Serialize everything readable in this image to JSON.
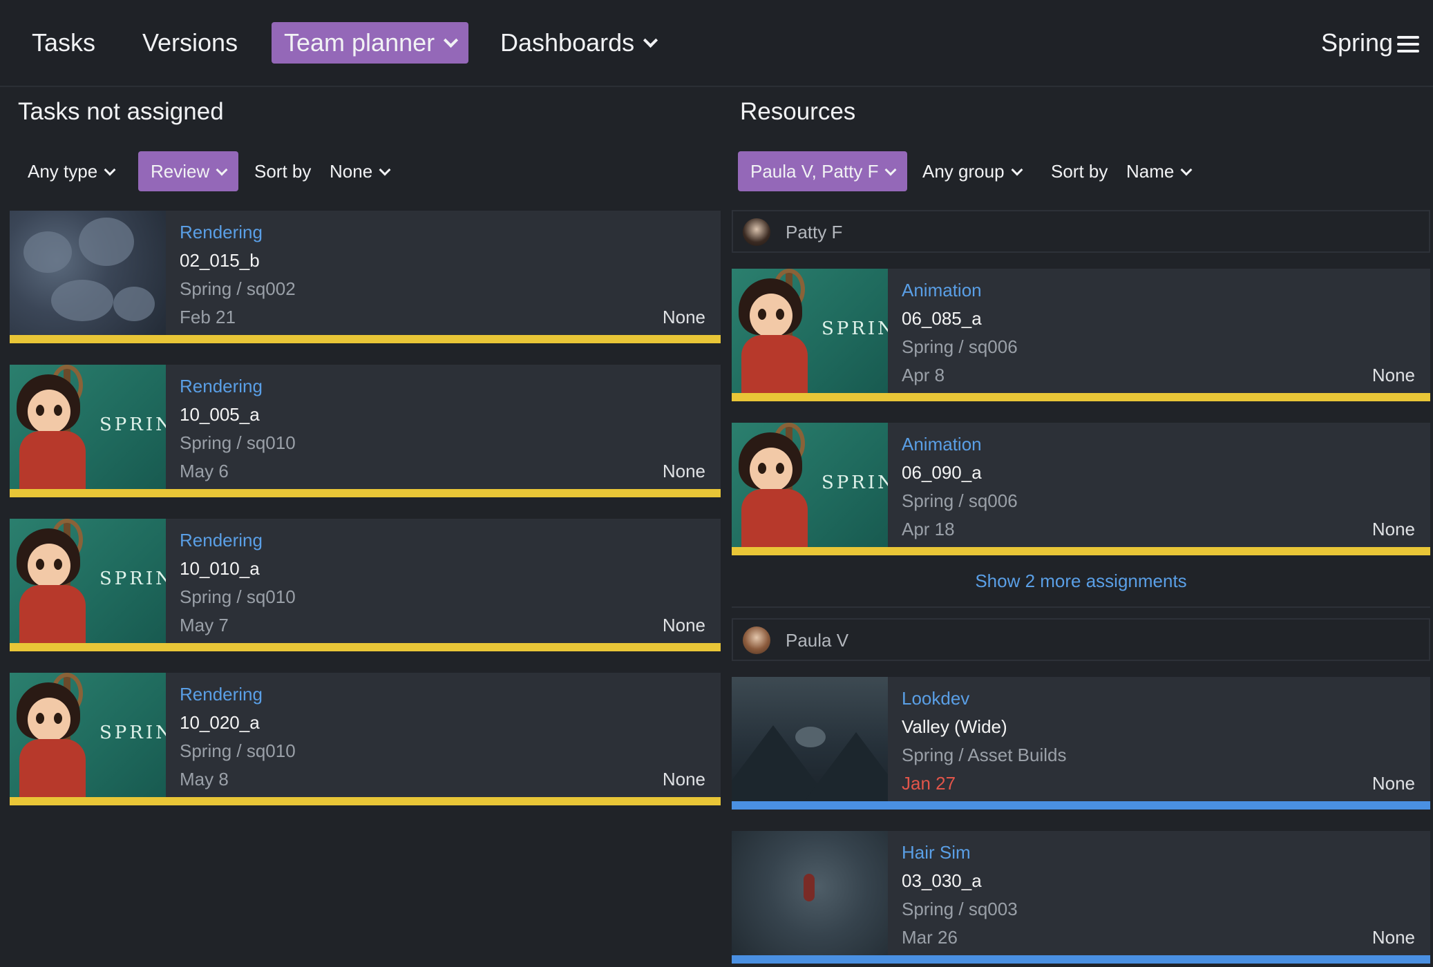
{
  "nav": {
    "tasks": "Tasks",
    "versions": "Versions",
    "team_planner": "Team planner",
    "dashboards": "Dashboards",
    "project": "Spring"
  },
  "left_panel": {
    "title": "Tasks not assigned",
    "filter_type": "Any type",
    "filter_status": "Review",
    "sort_label": "Sort by",
    "sort_value": "None",
    "tasks": [
      {
        "type": "Rendering",
        "name": "02_015_b",
        "path": "Spring / sq002",
        "date": "Feb 21",
        "estimate": "None"
      },
      {
        "type": "Rendering",
        "name": "10_005_a",
        "path": "Spring / sq010",
        "date": "May 6",
        "estimate": "None"
      },
      {
        "type": "Rendering",
        "name": "10_010_a",
        "path": "Spring / sq010",
        "date": "May 7",
        "estimate": "None"
      },
      {
        "type": "Rendering",
        "name": "10_020_a",
        "path": "Spring / sq010",
        "date": "May 8",
        "estimate": "None"
      }
    ]
  },
  "right_panel": {
    "title": "Resources",
    "filter_people": "Paula V, Patty F",
    "filter_group": "Any group",
    "sort_label": "Sort by",
    "sort_value": "Name",
    "show_more": "Show 2 more assignments",
    "people": [
      {
        "name": "Patty F",
        "tasks": [
          {
            "type": "Animation",
            "name": "06_085_a",
            "path": "Spring / sq006",
            "date": "Apr 8",
            "estimate": "None"
          },
          {
            "type": "Animation",
            "name": "06_090_a",
            "path": "Spring / sq006",
            "date": "Apr 18",
            "estimate": "None"
          }
        ]
      },
      {
        "name": "Paula V",
        "tasks": [
          {
            "type": "Lookdev",
            "name": "Valley (Wide)",
            "path": "Spring / Asset Builds",
            "date": "Jan 27",
            "estimate": "None"
          },
          {
            "type": "Hair Sim",
            "name": "03_030_a",
            "path": "Spring / sq003",
            "date": "Mar 26",
            "estimate": "None"
          }
        ]
      }
    ]
  },
  "thumbnail_logo": "SPRING",
  "colors": {
    "accent_purple": "#9468b8",
    "status_yellow": "#e9c637",
    "status_blue": "#4a90e2",
    "link_blue": "#5a9fe6",
    "overdue_red": "#e2554a"
  }
}
